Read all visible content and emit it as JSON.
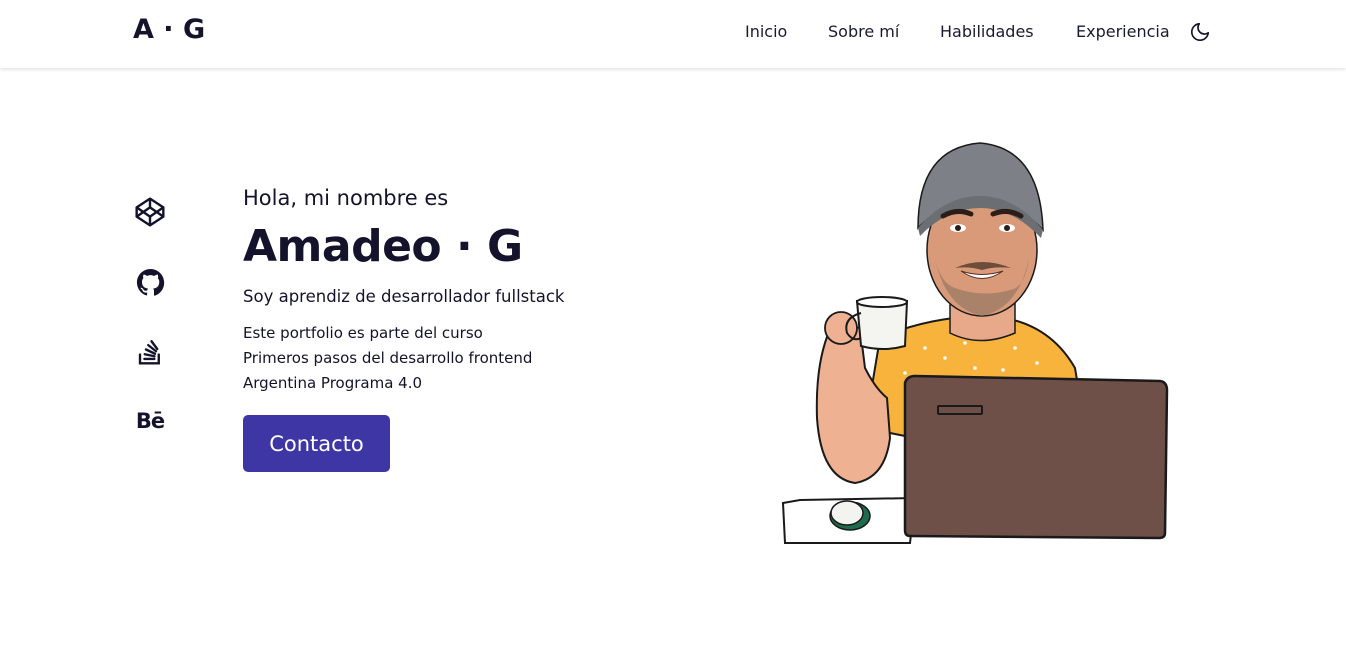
{
  "header": {
    "logo": "A · G",
    "nav": [
      {
        "label": "Inicio"
      },
      {
        "label": "Sobre mí"
      },
      {
        "label": "Habilidades"
      },
      {
        "label": "Experiencia"
      }
    ],
    "theme_icon": "moon-icon"
  },
  "socials": [
    {
      "name": "codepen",
      "icon": "codepen-icon"
    },
    {
      "name": "github",
      "icon": "github-icon"
    },
    {
      "name": "stackoverflow",
      "icon": "stackoverflow-icon"
    },
    {
      "name": "behance",
      "icon": "behance-icon",
      "text": "Bē"
    }
  ],
  "hero": {
    "greeting": "Hola, mi nombre es",
    "name": "Amadeo · G",
    "role": "Soy aprendiz de desarrollador fullstack",
    "description": [
      "Este portfolio es parte del curso",
      "Primeros pasos del desarrollo frontend",
      "Argentina Programa 4.0"
    ],
    "contact_label": "Contacto"
  },
  "colors": {
    "primary_button": "#3f36a6",
    "text": "#14132b"
  }
}
